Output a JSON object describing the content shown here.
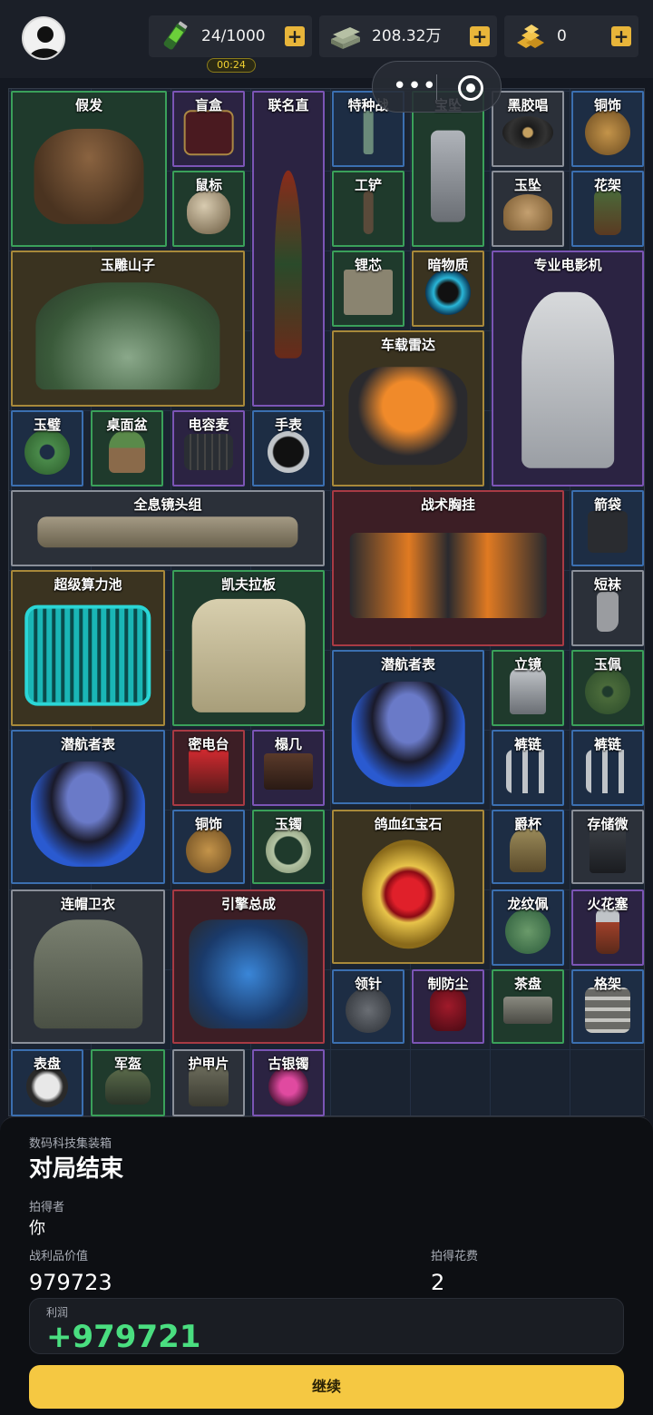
{
  "topbar": {
    "energy": "24/1000",
    "timer": "00:24",
    "money": "208.32万",
    "gold": "0",
    "plus": "+"
  },
  "grid": {
    "items": [
      {
        "label": "假发",
        "rarity": "green",
        "icon": "wig-icon"
      },
      {
        "label": "盲盒",
        "rarity": "purple",
        "icon": "blind-box-icon"
      },
      {
        "label": "联名直",
        "rarity": "purple",
        "icon": "umbrella-icon"
      },
      {
        "label": "特种战",
        "rarity": "blue",
        "icon": "knife-icon"
      },
      {
        "label": "宝坠",
        "rarity": "green",
        "icon": "dog-tag-icon"
      },
      {
        "label": "黑胶唱",
        "rarity": "white",
        "icon": "vinyl-record-icon"
      },
      {
        "label": "铜饰",
        "rarity": "blue",
        "icon": "bronze-ornament-icon"
      },
      {
        "label": "鼠标",
        "rarity": "green",
        "icon": "mouse-icon"
      },
      {
        "label": "工铲",
        "rarity": "green",
        "icon": "shovel-icon"
      },
      {
        "label": "玉坠",
        "rarity": "white",
        "icon": "jade-pendant-icon"
      },
      {
        "label": "花架",
        "rarity": "blue",
        "icon": "flower-stand-icon"
      },
      {
        "label": "玉雕山子",
        "rarity": "gold",
        "icon": "jade-sculpture-icon"
      },
      {
        "label": "锂芯",
        "rarity": "green",
        "icon": "battery-cell-icon"
      },
      {
        "label": "暗物质",
        "rarity": "gold",
        "icon": "dark-matter-icon"
      },
      {
        "label": "专业电影机",
        "rarity": "purple",
        "icon": "camera-icon"
      },
      {
        "label": "车载雷达",
        "rarity": "gold",
        "icon": "radar-icon"
      },
      {
        "label": "玉璧",
        "rarity": "blue",
        "icon": "jade-disc-icon"
      },
      {
        "label": "桌面盆",
        "rarity": "green",
        "icon": "potted-plant-icon"
      },
      {
        "label": "电容麦",
        "rarity": "purple",
        "icon": "keyboard-icon"
      },
      {
        "label": "手表",
        "rarity": "blue",
        "icon": "wristwatch-icon"
      },
      {
        "label": "全息镜头组",
        "rarity": "white",
        "icon": "lens-group-icon"
      },
      {
        "label": "战术胸挂",
        "rarity": "red",
        "icon": "tactical-vest-icon"
      },
      {
        "label": "箭袋",
        "rarity": "blue",
        "icon": "quiver-icon"
      },
      {
        "label": "超级算力池",
        "rarity": "gold",
        "icon": "compute-pool-icon"
      },
      {
        "label": "凯夫拉板",
        "rarity": "green",
        "icon": "kevlar-plate-icon"
      },
      {
        "label": "短袜",
        "rarity": "white",
        "icon": "sock-icon"
      },
      {
        "label": "潜航者表",
        "rarity": "blue",
        "icon": "diving-mask-icon"
      },
      {
        "label": "立镜",
        "rarity": "green",
        "icon": "mirror-icon"
      },
      {
        "label": "玉佩",
        "rarity": "green",
        "icon": "jade-coin-icon"
      },
      {
        "label": "潜航者表",
        "rarity": "blue",
        "icon": "diving-mask-icon"
      },
      {
        "label": "密电台",
        "rarity": "red",
        "icon": "radio-icon"
      },
      {
        "label": "榻几",
        "rarity": "purple",
        "icon": "low-table-icon"
      },
      {
        "label": "裤链",
        "rarity": "blue",
        "icon": "chain-icon"
      },
      {
        "label": "裤链",
        "rarity": "blue",
        "icon": "chain-icon"
      },
      {
        "label": "铜饰",
        "rarity": "blue",
        "icon": "bronze-ornament-icon"
      },
      {
        "label": "玉镯",
        "rarity": "green",
        "icon": "jade-bracelet-icon"
      },
      {
        "label": "鸽血红宝石",
        "rarity": "gold",
        "icon": "ruby-icon"
      },
      {
        "label": "爵杯",
        "rarity": "blue",
        "icon": "wine-vessel-icon"
      },
      {
        "label": "存储微",
        "rarity": "white",
        "icon": "micro-sd-icon"
      },
      {
        "label": "连帽卫衣",
        "rarity": "white",
        "icon": "hoodie-icon"
      },
      {
        "label": "引擎总成",
        "rarity": "red",
        "icon": "engine-icon"
      },
      {
        "label": "龙纹佩",
        "rarity": "blue",
        "icon": "dragon-pendant-icon"
      },
      {
        "label": "火花塞",
        "rarity": "purple",
        "icon": "spark-plug-icon"
      },
      {
        "label": "领针",
        "rarity": "blue",
        "icon": "lapel-pin-icon"
      },
      {
        "label": "制防尘",
        "rarity": "purple",
        "icon": "dust-bag-icon"
      },
      {
        "label": "茶盘",
        "rarity": "green",
        "icon": "tea-tray-icon"
      },
      {
        "label": "格架",
        "rarity": "blue",
        "icon": "shelf-icon"
      },
      {
        "label": "表盘",
        "rarity": "blue",
        "icon": "watch-dial-icon"
      },
      {
        "label": "军盔",
        "rarity": "green",
        "icon": "helmet-icon"
      },
      {
        "label": "护甲片",
        "rarity": "white",
        "icon": "armor-plate-icon"
      },
      {
        "label": "古银镯",
        "rarity": "purple",
        "icon": "silver-bracelet-icon"
      }
    ]
  },
  "result": {
    "container": "数码科技集装箱",
    "title": "对局结束",
    "winner_label": "拍得者",
    "winner": "你",
    "loot_value_label": "战利品价值",
    "loot_value": "979723",
    "cost_label": "拍得花费",
    "cost": "2",
    "profit_label": "利润",
    "profit": "+979721",
    "continue": "继续"
  },
  "colors": {
    "accent_yellow": "#f5c842",
    "profit_green": "#4ade80",
    "rarity_green": "#3aa05a",
    "rarity_purple": "#7b55b5",
    "rarity_blue": "#3b6fb0",
    "rarity_gold": "#a8893a",
    "rarity_red": "#a83a44"
  }
}
